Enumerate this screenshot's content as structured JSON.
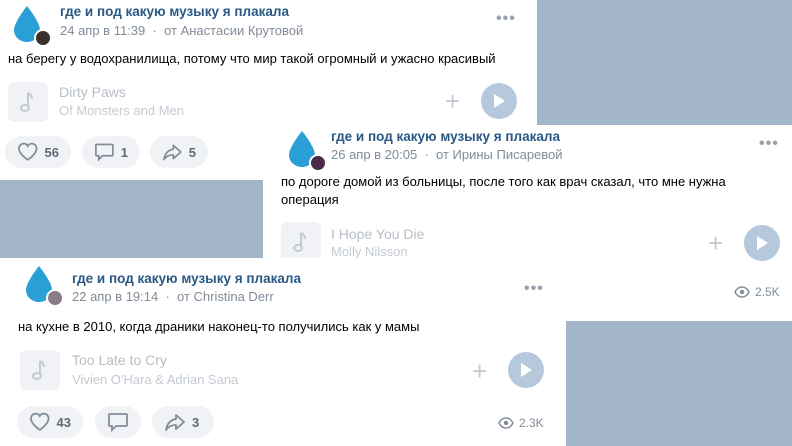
{
  "posts": [
    {
      "group": "где и под какую музыку я плакала",
      "date": "24 апр в 11:39",
      "author": "от Анастасии Крутовой",
      "text": "на берегу у водохранилища, потому что мир такой огромный и ужасно красивый",
      "track": {
        "title": "Dirty Paws",
        "artist": "Of Monsters and Men"
      },
      "likes": "56",
      "comments": "1",
      "shares": "5"
    },
    {
      "group": "где и под какую музыку я плакала",
      "date": "26 апр в 20:05",
      "author": "от Ирины Писаревой",
      "text": "по дороге домой из больницы, после того как врач сказал, что мне нужна операция",
      "track": {
        "title": "I Hope You Die",
        "artist": "Molly Nilsson"
      },
      "views": "2.5K"
    },
    {
      "group": "где и под какую музыку я плакала",
      "date": "22 апр в 19:14",
      "author": "от Christina Derr",
      "text": "на кухне в 2010, когда драники наконец-то получились как у мамы",
      "track": {
        "title": "Too Late to Cry",
        "artist": "Vivien O'Hara & Adrian Sana"
      },
      "likes": "43",
      "shares": "3",
      "views": "2.3K"
    }
  ],
  "colors": {
    "background": "#a3b6c8",
    "link": "#2a5885",
    "drop": "#2a9fd6"
  }
}
